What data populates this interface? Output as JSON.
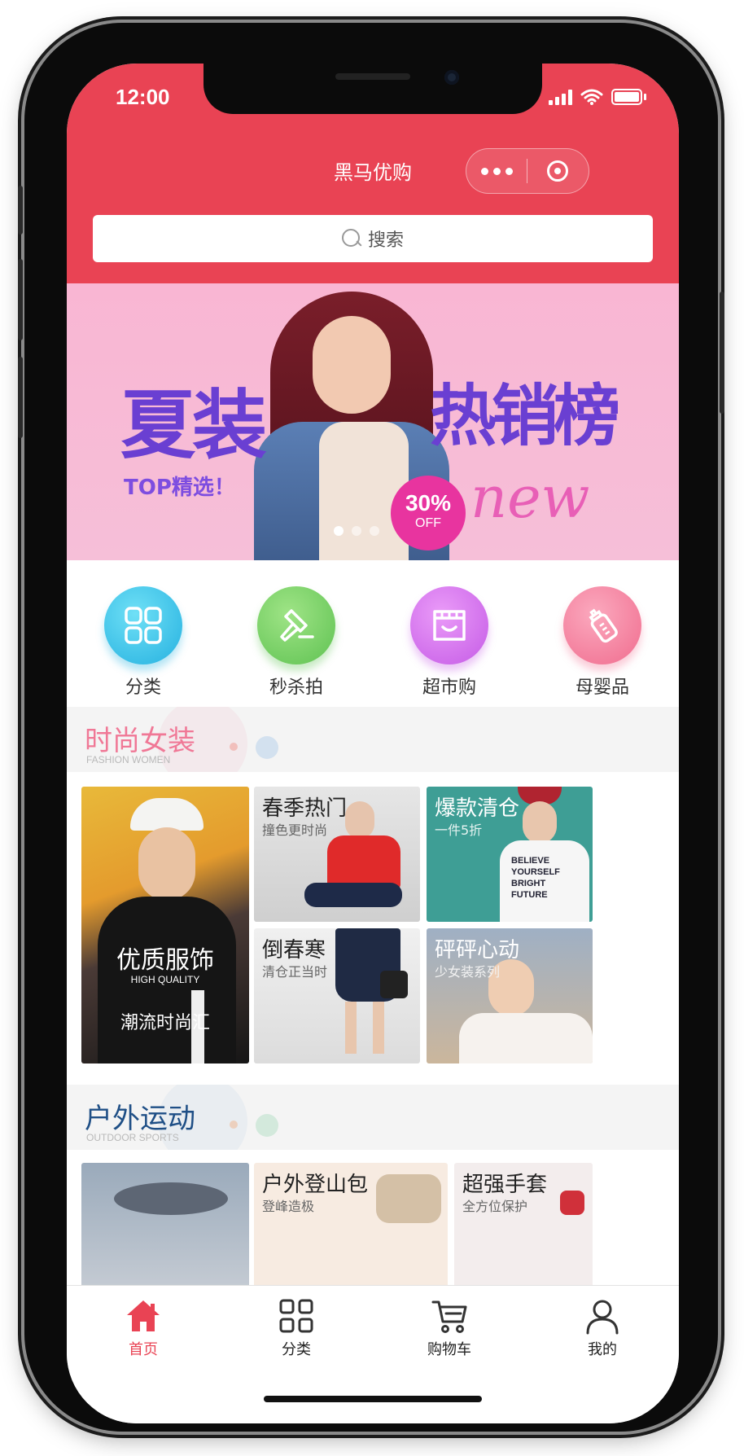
{
  "status_bar": {
    "time": "12:00"
  },
  "nav": {
    "title": "黑马优购"
  },
  "search": {
    "placeholder": "搜索"
  },
  "banner": {
    "left_text": "夏装",
    "right_text": "热销榜",
    "top_text": "TOP精选！",
    "discount": "30%",
    "off": "OFF",
    "new_text": "new"
  },
  "quick_nav": [
    {
      "label": "分类",
      "icon": "grid-icon",
      "color": "#3cc3e6"
    },
    {
      "label": "秒杀拍",
      "icon": "hammer-icon",
      "color": "#76d36b"
    },
    {
      "label": "超市购",
      "icon": "shop-icon",
      "color": "#d66ef0"
    },
    {
      "label": "母婴品",
      "icon": "bottle-icon",
      "color": "#f57ea0"
    }
  ],
  "sections": [
    {
      "title": "时尚女装",
      "subtitle": "FASHION WOMEN",
      "title_color": "#f07896",
      "main": {
        "title": "优质服饰",
        "subtitle": "HIGH QUALITY",
        "tag": "潮流时尚汇"
      },
      "tiles": [
        {
          "title": "春季热门",
          "subtitle": "撞色更时尚"
        },
        {
          "title": "爆款清仓",
          "subtitle": "一件5折"
        },
        {
          "title": "倒春寒",
          "subtitle": "清仓正当时"
        },
        {
          "title": "砰砰心动",
          "subtitle": "少女装系列"
        }
      ]
    },
    {
      "title": "户外运动",
      "subtitle": "OUTDOOR SPORTS",
      "title_color": "#1f4f86",
      "tiles": [
        {
          "title": "户外登山包",
          "subtitle": "登峰造极"
        },
        {
          "title": "超强手套",
          "subtitle": "全方位保护"
        }
      ]
    }
  ],
  "tabbar": [
    {
      "label": "首页",
      "icon": "home-icon",
      "active": true
    },
    {
      "label": "分类",
      "icon": "category-icon",
      "active": false
    },
    {
      "label": "购物车",
      "icon": "cart-icon",
      "active": false
    },
    {
      "label": "我的",
      "icon": "user-icon",
      "active": false
    }
  ],
  "colors": {
    "brand": "#e94354",
    "active_tab": "#e94354"
  }
}
